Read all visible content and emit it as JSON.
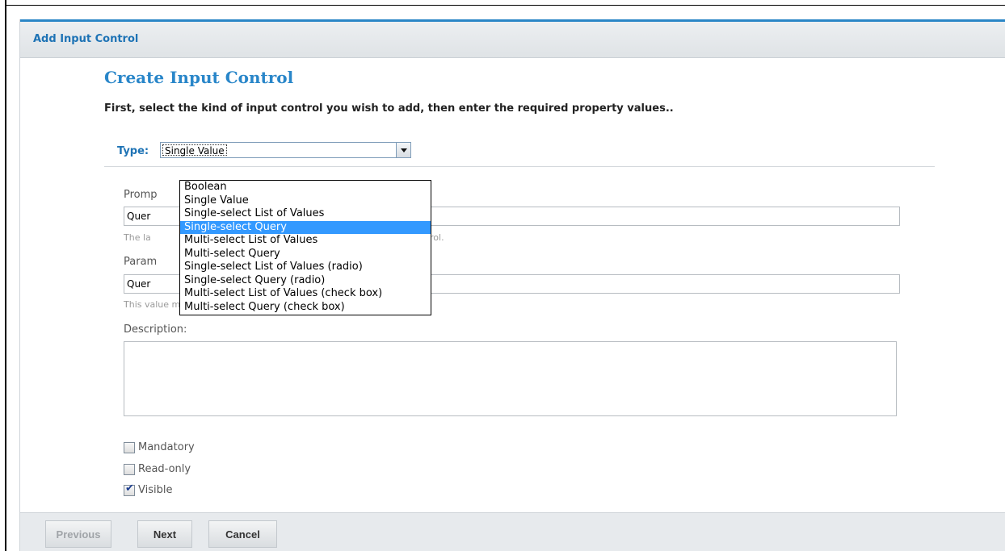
{
  "dialog": {
    "title": "Add Input Control",
    "heading": "Create Input Control",
    "instruction": "First, select the kind of input control you wish to add, then enter the required property values.."
  },
  "type_select": {
    "label": "Type:",
    "selected": "Single Value",
    "options": [
      "Boolean",
      "Single Value",
      "Single-select List of Values",
      "Single-select Query",
      "Multi-select List of Values",
      "Multi-select Query",
      "Single-select List of Values (radio)",
      "Single-select Query (radio)",
      "Multi-select List of Values (check box)",
      "Multi-select Query (check box)"
    ],
    "highlighted_option": "Single-select Query"
  },
  "prompt": {
    "label": "Promp",
    "value": "Quer",
    "hint_start": "The la",
    "hint_end": "ontrol."
  },
  "parameter": {
    "label": "Param",
    "value": "Quer",
    "hint": "This value must match the name of the parameter in your report."
  },
  "description": {
    "label": "Description:",
    "value": ""
  },
  "checkboxes": [
    {
      "label": "Mandatory",
      "checked": false
    },
    {
      "label": "Read-only",
      "checked": false
    },
    {
      "label": "Visible",
      "checked": true
    }
  ],
  "footer": {
    "previous_label": "Previous",
    "next_label": "Next",
    "cancel_label": "Cancel"
  },
  "colors": {
    "accent": "#2986c9",
    "highlight": "#3399ff",
    "title_bar_border": "#2a86c6"
  }
}
